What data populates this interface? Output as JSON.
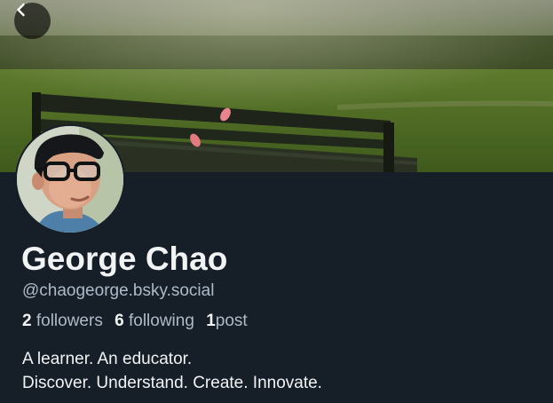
{
  "profile": {
    "display_name": "George Chao",
    "handle": "@chaogeorge.bsky.social",
    "followers_count": "2",
    "followers_label": "followers",
    "following_count": "6",
    "following_label": "following",
    "posts_count": "1",
    "posts_label": "post",
    "bio_line_1": "A learner. An educator.",
    "bio_line_2": "Discover. Understand. Create. Innovate."
  },
  "icons": {
    "back": "chevron-left-icon"
  },
  "colors": {
    "background": "#161e27",
    "primary_text": "#f1f3f5",
    "secondary_text": "#aebbc9"
  }
}
